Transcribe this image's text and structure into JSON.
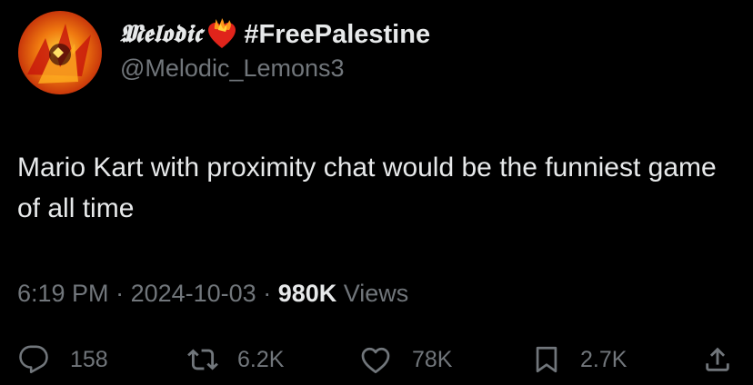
{
  "author": {
    "display_name": "𝕸𝖊𝖑𝖔𝖉𝖎𝖈",
    "hashtag": "#FreePalestine",
    "handle": "@Melodic_Lemons3"
  },
  "tweet": {
    "text": "Mario Kart with proximity chat would be the funniest game of all time"
  },
  "meta": {
    "time": "6:19 PM",
    "sep1": " · ",
    "date": "2024-10-03",
    "sep2": " · ",
    "views_count": "980K",
    "views_label": " Views"
  },
  "actions": {
    "replies": "158",
    "reposts": "6.2K",
    "likes": "78K",
    "bookmarks": "2.7K"
  },
  "icons": {
    "avatar": "avatar",
    "heart": "fire-heart-icon",
    "reply": "reply-icon",
    "repost": "repost-icon",
    "like": "heart-icon",
    "bookmark": "bookmark-icon",
    "share": "share-icon"
  },
  "colors": {
    "background": "#000000",
    "primary_text": "#e7e9ea",
    "secondary_text": "#71767b"
  }
}
